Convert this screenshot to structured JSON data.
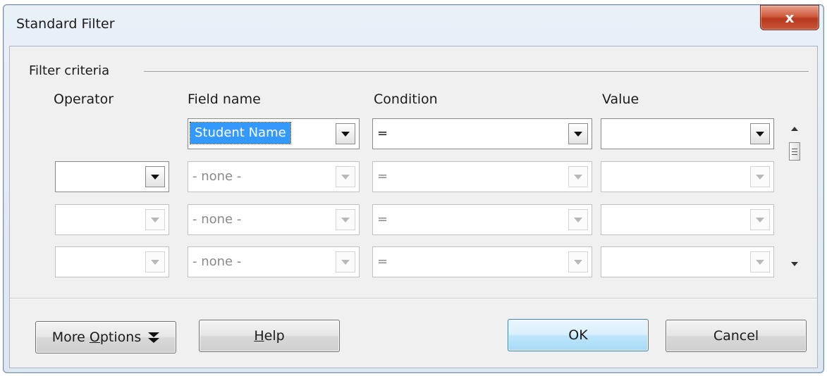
{
  "window": {
    "title": "Standard Filter",
    "close_label": "x"
  },
  "group": {
    "label": "Filter criteria"
  },
  "columns": {
    "operator": "Operator",
    "field_name": "Field name",
    "condition": "Condition",
    "value": "Value"
  },
  "rows": [
    {
      "operator": "",
      "field": "Student Name",
      "condition": "=",
      "value": ""
    },
    {
      "operator": "",
      "field": "- none -",
      "condition": "=",
      "value": ""
    },
    {
      "operator": "",
      "field": "- none -",
      "condition": "=",
      "value": ""
    },
    {
      "operator": "",
      "field": "- none -",
      "condition": "=",
      "value": ""
    }
  ],
  "buttons": {
    "more_options_pre": "More ",
    "more_options_mnemonic": "O",
    "more_options_post": "ptions",
    "help_mnemonic": "H",
    "help_post": "elp",
    "ok": "OK",
    "cancel": "Cancel"
  },
  "icons": {
    "dropdown": "chevron-down-icon",
    "scroll_up": "arrow-up-icon",
    "scroll_down": "arrow-down-icon",
    "more_options": "double-chevron-down-icon"
  }
}
